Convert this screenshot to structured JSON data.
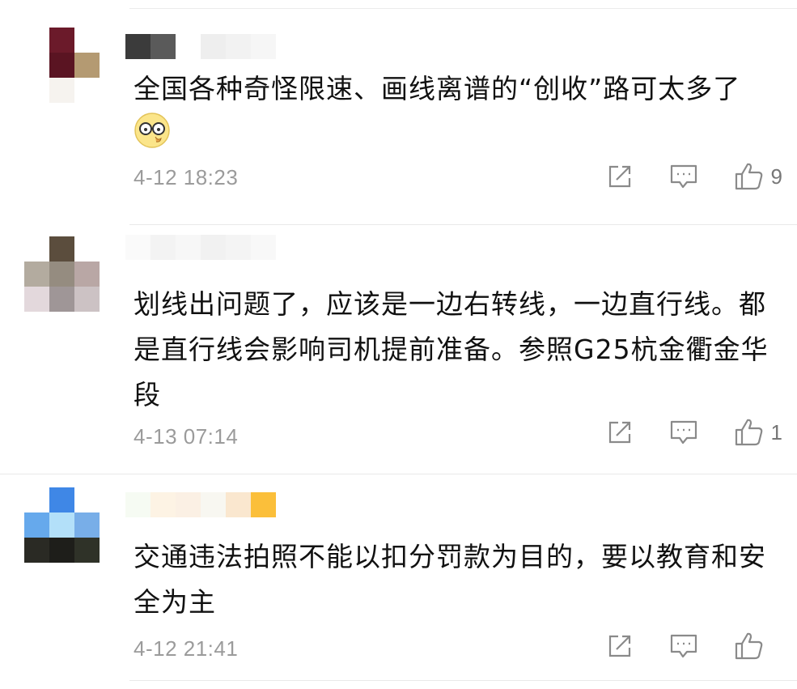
{
  "comments": [
    {
      "text": "全国各种奇怪限速、画线离谱的“创收”路可太多了",
      "has_emoji": true,
      "emoji_icon": "eyeglasses-emoji-icon",
      "time": "4-12 18:23",
      "likes": "9",
      "avatar_colors": [
        "#ffffff",
        "#6b1a2a",
        "#ffffff",
        "#ffffff",
        "#5a1422",
        "#b49a72",
        "#ffffff",
        "#f6f3ef",
        "#ffffff"
      ],
      "username_colors": [
        "#3b3b3b",
        "#5a5a5a",
        "#ffffff",
        "#eeeeee",
        "#f2f2f2",
        "#f6f6f6"
      ]
    },
    {
      "text": "划线出问题了，应该是一边右转线，一边直行线。都是直行线会影响司机提前准备。参照G25杭金衢金华段",
      "has_emoji": false,
      "time": "4-13 07:14",
      "likes": "1",
      "avatar_colors": [
        "#ffffff",
        "#5b4d3d",
        "#ffffff",
        "#b3ab9f",
        "#958c80",
        "#b9a7a5",
        "#e3d8dc",
        "#9f9697",
        "#ccc2c4"
      ],
      "username_colors": [
        "#fafafa",
        "#f3f3f3",
        "#f7f7f7",
        "#f1f1f1",
        "#f4f4f4",
        "#f8f8f8"
      ]
    },
    {
      "text": "交通违法拍照不能以扣分罚款为目的，要以教育和安全为主",
      "has_emoji": false,
      "time": "4-12 21:41",
      "likes": "",
      "avatar_colors": [
        "#ffffff",
        "#3f87e6",
        "#ffffff",
        "#66a9ec",
        "#b3e0f9",
        "#78aee8",
        "#2a2a24",
        "#1e1e1a",
        "#2f3228"
      ],
      "username_colors": [
        "#f6fbf3",
        "#fdf3e4",
        "#fbf0e4",
        "#f8f7f1",
        "#fae7cf",
        "#fbbf3a"
      ]
    }
  ],
  "icons": {
    "share": "share-icon",
    "reply": "reply-comment-icon",
    "like": "thumbs-up-icon"
  },
  "colors": {
    "text": "#111111",
    "meta": "#9b9b9b",
    "icon": "#8a8a8a",
    "divider": "#e9e9e9"
  }
}
